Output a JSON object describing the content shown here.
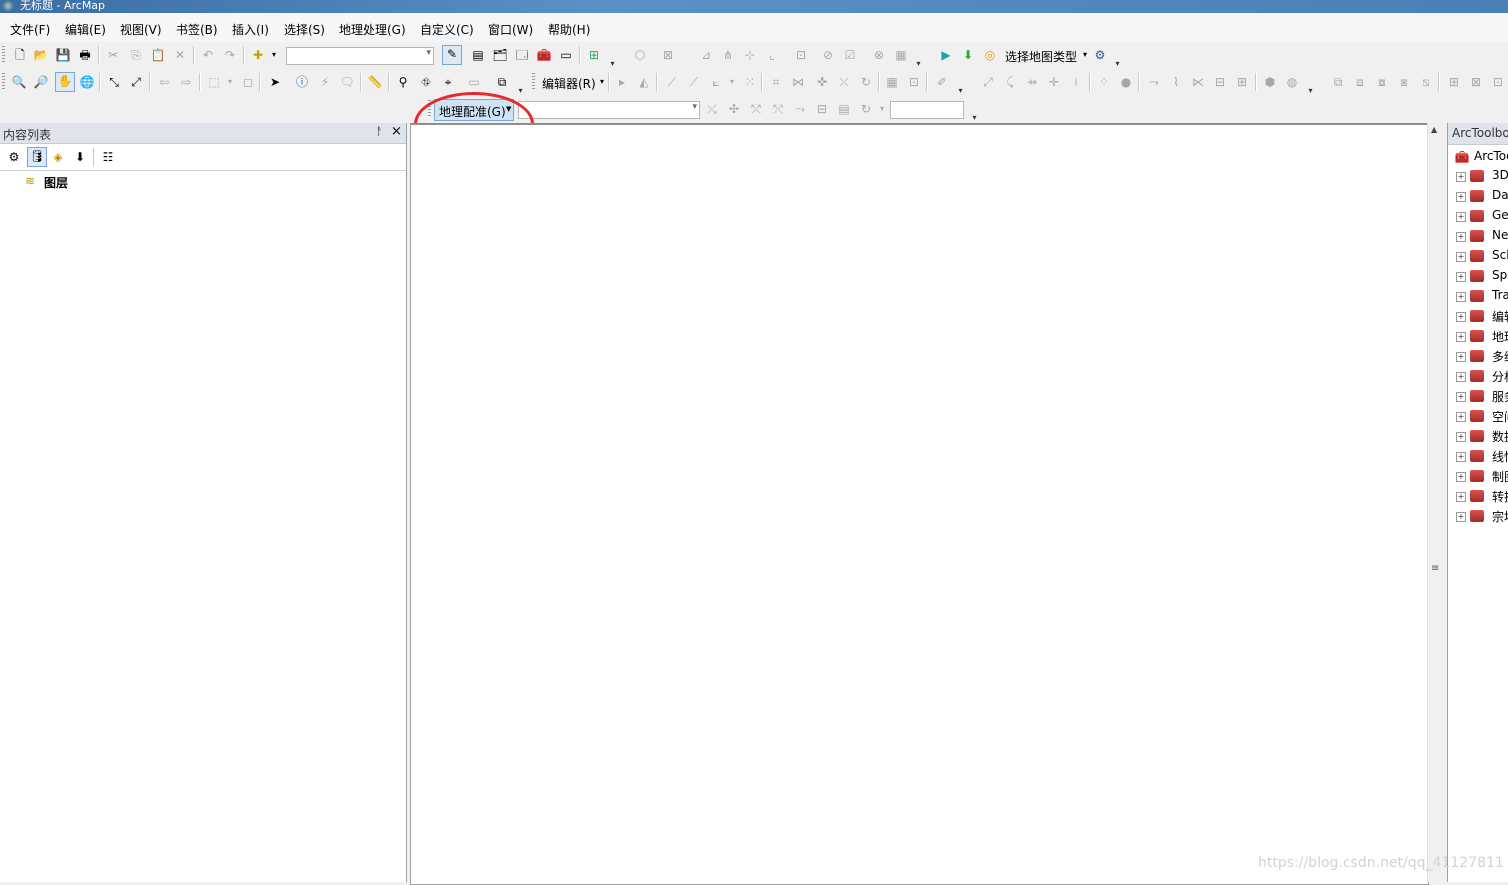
{
  "window": {
    "title": "无标题 - ArcMap"
  },
  "menu": [
    "文件(F)",
    "编辑(E)",
    "视图(V)",
    "书签(B)",
    "插入(I)",
    "选择(S)",
    "地理处理(G)",
    "自定义(C)",
    "窗口(W)",
    "帮助(H)"
  ],
  "toolbar": {
    "select_map_type": "选择地图类型",
    "editor": "编辑器(R)",
    "georef": "地理配准(G)"
  },
  "toc": {
    "title": "内容列表",
    "layers_label": "图层"
  },
  "toolbox": {
    "title": "ArcToolbox",
    "root": "ArcToolbox",
    "items": [
      "3D",
      "Da",
      "Ge",
      "Ne",
      "Scl",
      "Sp",
      "Tra",
      "编辑",
      "地理",
      "多维",
      "分析",
      "服务",
      "空间",
      "数据",
      "线性",
      "制图",
      "转换",
      "宗地"
    ]
  },
  "watermark": "https://blog.csdn.net/qq_41127811"
}
